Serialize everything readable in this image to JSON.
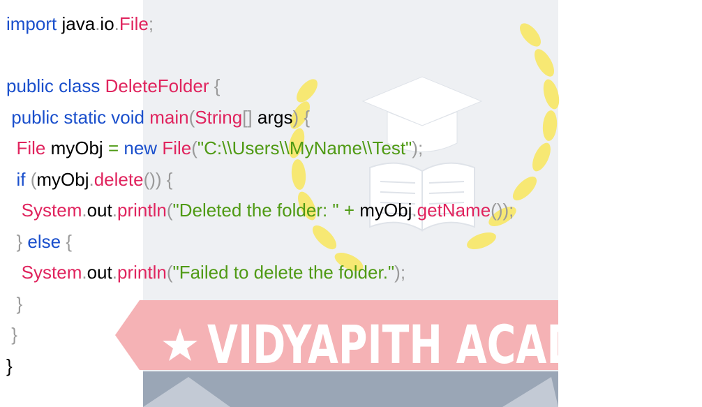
{
  "watermark": {
    "brand_text": "VIDYAPITH ACADEMY",
    "colors": {
      "band": "#f5b2b5",
      "band_text": "#ffffff",
      "panel": "#9aa6b6",
      "panel_light": "#c3cad5",
      "wreath": "#f7e873",
      "cap_book": "#ffffff"
    },
    "icons": [
      "graduation-cap-icon",
      "open-book-icon",
      "laurel-wreath-icon",
      "star-icon"
    ]
  },
  "code": {
    "lines": [
      [
        [
          "keyword",
          "import"
        ],
        [
          "plain",
          " "
        ],
        [
          "ident",
          "java"
        ],
        [
          "punct",
          "."
        ],
        [
          "ident",
          "io"
        ],
        [
          "punct",
          "."
        ],
        [
          "type",
          "File"
        ],
        [
          "punct",
          ";"
        ]
      ],
      [],
      [
        [
          "keyword",
          "public class"
        ],
        [
          "plain",
          " "
        ],
        [
          "type",
          "DeleteFolder"
        ],
        [
          "plain",
          " "
        ],
        [
          "punct",
          "{"
        ]
      ],
      [
        [
          "plain",
          " "
        ],
        [
          "keyword",
          "public static void"
        ],
        [
          "plain",
          " "
        ],
        [
          "type",
          "main"
        ],
        [
          "punct",
          "("
        ],
        [
          "type",
          "String"
        ],
        [
          "punct",
          "[]"
        ],
        [
          "plain",
          " "
        ],
        [
          "ident",
          "args"
        ],
        [
          "punct",
          ")"
        ],
        [
          "plain",
          " "
        ],
        [
          "punct",
          "{"
        ]
      ],
      [
        [
          "plain",
          "  "
        ],
        [
          "type",
          "File"
        ],
        [
          "plain",
          " "
        ],
        [
          "ident",
          "myObj"
        ],
        [
          "plain",
          " "
        ],
        [
          "op",
          "="
        ],
        [
          "plain",
          " "
        ],
        [
          "keyword",
          "new"
        ],
        [
          "plain",
          " "
        ],
        [
          "type",
          "File"
        ],
        [
          "punct",
          "("
        ],
        [
          "string",
          "\"C:\\\\Users\\\\MyName\\\\Test\""
        ],
        [
          "punct",
          ");"
        ]
      ],
      [
        [
          "plain",
          "  "
        ],
        [
          "keyword",
          "if"
        ],
        [
          "plain",
          " "
        ],
        [
          "punct",
          "("
        ],
        [
          "ident",
          "myObj"
        ],
        [
          "punct",
          "."
        ],
        [
          "type",
          "delete"
        ],
        [
          "punct",
          "()) {"
        ]
      ],
      [
        [
          "plain",
          "   "
        ],
        [
          "type",
          "System"
        ],
        [
          "punct",
          "."
        ],
        [
          "ident",
          "out"
        ],
        [
          "punct",
          "."
        ],
        [
          "type",
          "println"
        ],
        [
          "punct",
          "("
        ],
        [
          "string",
          "\"Deleted the folder: \""
        ],
        [
          "plain",
          " "
        ],
        [
          "op",
          "+"
        ],
        [
          "plain",
          " "
        ],
        [
          "ident",
          "myObj"
        ],
        [
          "punct",
          "."
        ],
        [
          "type",
          "getName"
        ],
        [
          "punct",
          "());"
        ]
      ],
      [
        [
          "plain",
          "  "
        ],
        [
          "punct",
          "}"
        ],
        [
          "plain",
          " "
        ],
        [
          "keyword",
          "else"
        ],
        [
          "plain",
          " "
        ],
        [
          "punct",
          "{"
        ]
      ],
      [
        [
          "plain",
          "   "
        ],
        [
          "type",
          "System"
        ],
        [
          "punct",
          "."
        ],
        [
          "ident",
          "out"
        ],
        [
          "punct",
          "."
        ],
        [
          "type",
          "println"
        ],
        [
          "punct",
          "("
        ],
        [
          "string",
          "\"Failed to delete the folder.\""
        ],
        [
          "punct",
          ");"
        ]
      ],
      [
        [
          "plain",
          "  "
        ],
        [
          "punct",
          "}"
        ]
      ],
      [
        [
          "plain",
          " "
        ],
        [
          "punct",
          "}"
        ]
      ],
      [
        [
          "plain",
          ""
        ],
        [
          "ident",
          "}"
        ]
      ]
    ]
  }
}
